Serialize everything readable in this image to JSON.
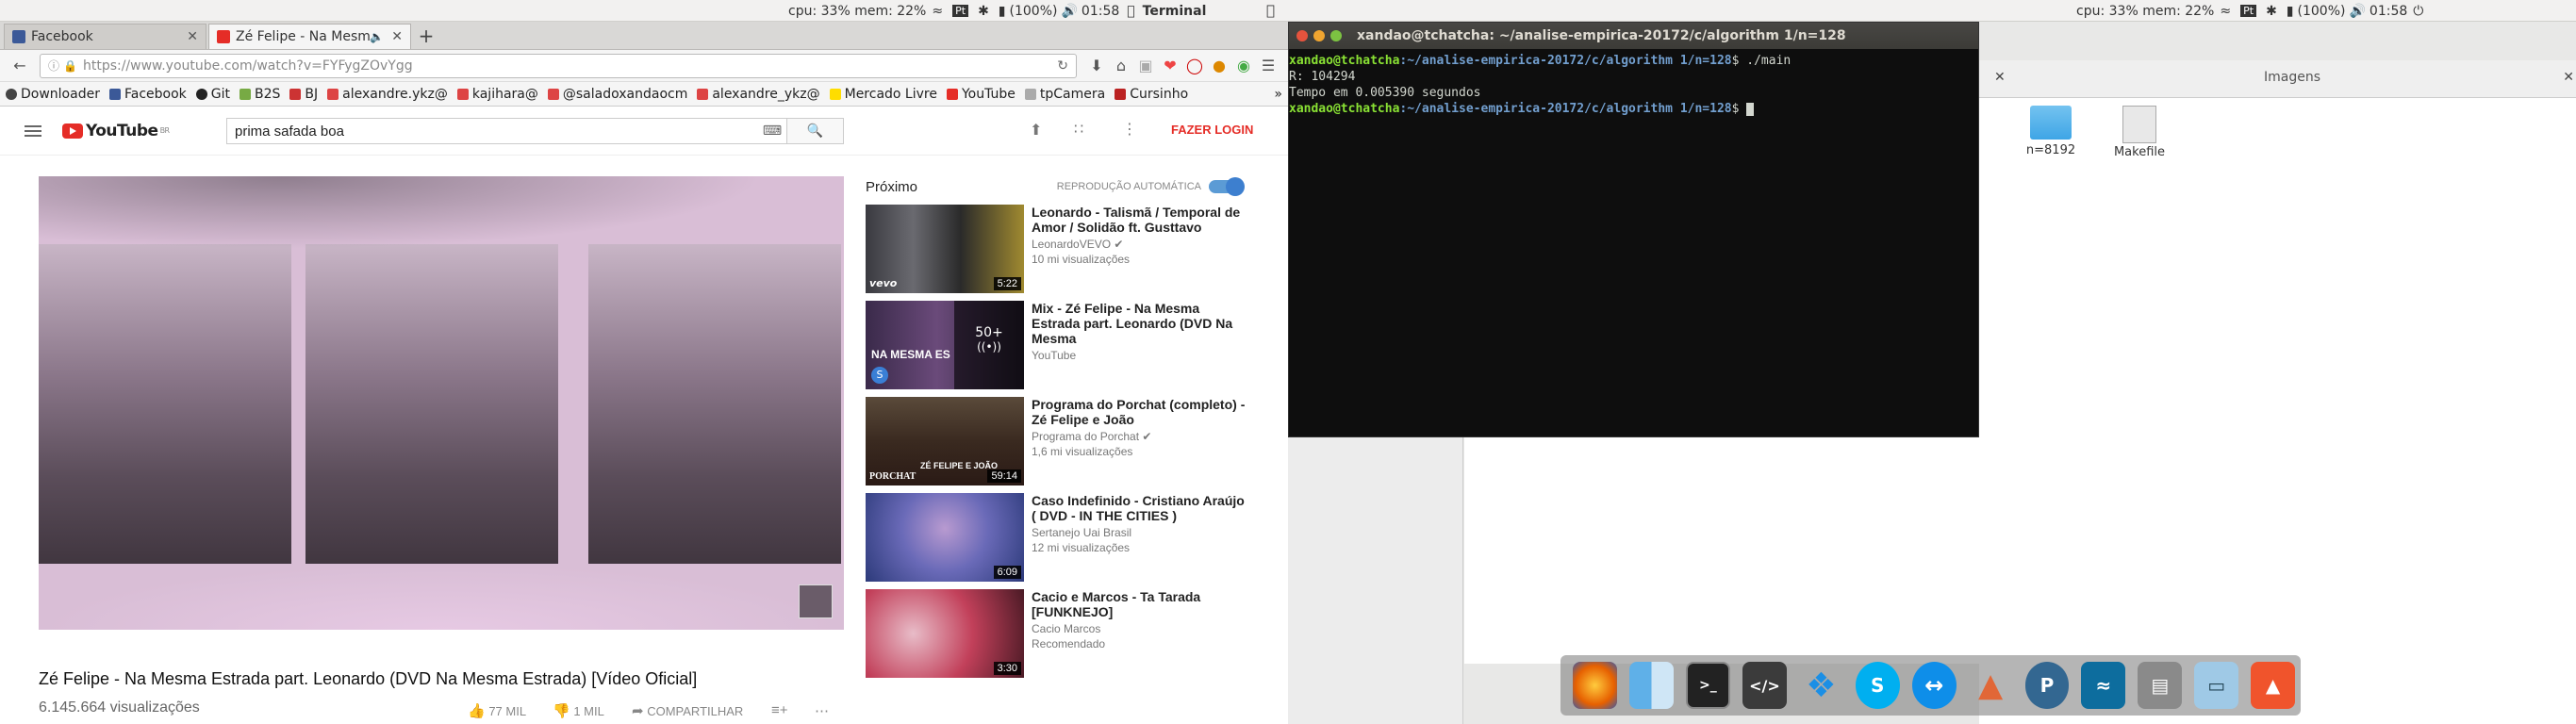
{
  "top_panel": {
    "cpu_mem": "cpu: 33% mem: 22%",
    "battery": "(100%)",
    "time": "01:58",
    "app_name": "Terminal",
    "flag_badge": "Pt"
  },
  "firefox": {
    "tabs": [
      {
        "label": "Facebook"
      },
      {
        "label": "Zé Felipe - Na Mesm"
      }
    ],
    "url": "https://www.youtube.com/watch?v=FYFygZOvYgg",
    "bookmarks": [
      "Downloader",
      "Facebook",
      "Git",
      "B2S",
      "BJ",
      "alexandre.ykz@",
      "kajihara@",
      "@saladoxandaocm",
      "alexandre_ykz@",
      "Mercado Livre",
      "YouTube",
      "tpCamera",
      "Cursinho"
    ]
  },
  "youtube": {
    "logo": "YouTube",
    "logo_region": "BR",
    "search_value": "prima safada boa",
    "login": "FAZER LOGIN",
    "video_title": "Zé Felipe - Na Mesma Estrada part. Leonardo (DVD Na Mesma Estrada) [Vídeo Oficial]",
    "views": "6.145.664 visualizações",
    "likes": "77 MIL",
    "dislikes": "1 MIL",
    "share": "COMPARTILHAR",
    "next_label": "Próximo",
    "autoplay_label": "REPRODUÇÃO AUTOMÁTICA",
    "related": [
      {
        "title": "Leonardo - Talismã / Temporal de Amor / Solidão ft. Gusttavo",
        "channel": "LeonardoVEVO",
        "views": "10 mi visualizações",
        "duration": "5:22",
        "badge": "vevo"
      },
      {
        "title": "Mix - Zé Felipe - Na Mesma Estrada part. Leonardo (DVD Na Mesma",
        "channel": "YouTube",
        "views": "",
        "duration": "",
        "playlist_count": "50+",
        "overlay": "NA MESMA ES"
      },
      {
        "title": "Programa do Porchat (completo) - Zé Felipe e João",
        "channel": "Programa do Porchat",
        "views": "1,6 mi visualizações",
        "duration": "59:14",
        "overlay": "ZÉ FELIPE E JOÃO"
      },
      {
        "title": "Caso Indefinido - Cristiano Araújo ( DVD - IN THE CITIES )",
        "channel": "Sertanejo Uai Brasil",
        "views": "12 mi visualizações",
        "duration": "6:09"
      },
      {
        "title": "Cacio e Marcos - Ta Tarada [FUNKNEJO]",
        "channel": "Cacio Marcos",
        "views": "Recomendado",
        "duration": "3:30"
      }
    ]
  },
  "terminal": {
    "title": "xandao@tchatcha: ~/analise-empirica-20172/c/algorithm 1/n=128",
    "prompt_user": "xandao@tchatcha",
    "prompt_path": ":~/analise-empirica-20172/c/algorithm 1/n=128",
    "command": " ./main",
    "out1": "R: 104294",
    "out2": "Tempo em 0.005390 segundos"
  },
  "files": {
    "tab_title": "Imagens",
    "items": [
      {
        "name": "n=8192"
      },
      {
        "name": "Makefile"
      }
    ]
  },
  "colors": {
    "yt_red": "#e52d27",
    "term_green": "#8ae234",
    "term_blue": "#729fcf"
  }
}
